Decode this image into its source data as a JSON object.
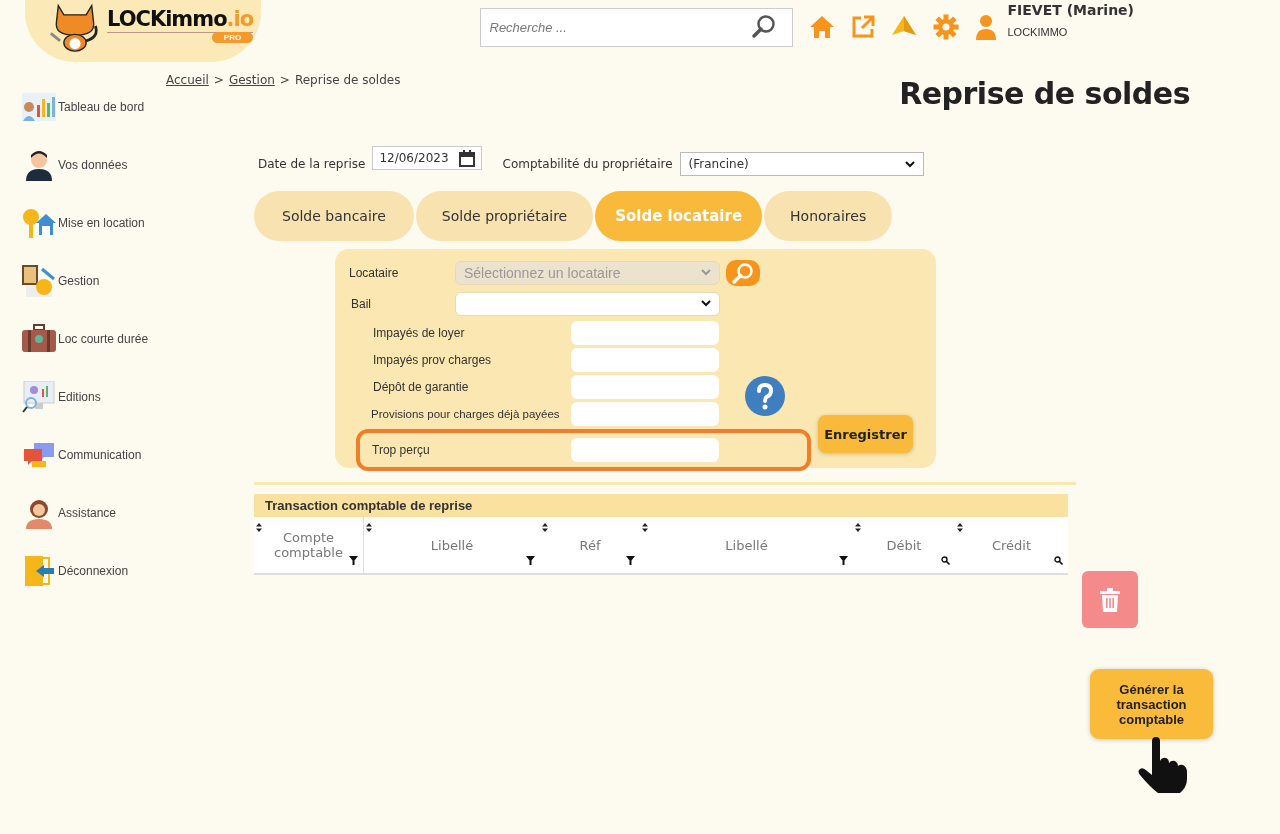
{
  "header": {
    "logo": {
      "name": "LOCKimmo",
      "suffix": ".io",
      "badge": "PRO"
    },
    "search": {
      "placeholder": "Recherche ..."
    },
    "user": {
      "name": "FIEVET (Marine)",
      "company": "LOCKIMMO"
    }
  },
  "breadcrumb": {
    "separator": ">",
    "items": [
      {
        "label": "Accueil",
        "link": true
      },
      {
        "label": "Gestion",
        "link": true
      },
      {
        "label": "Reprise de soldes",
        "link": false
      }
    ]
  },
  "page_title": "Reprise de soldes",
  "sidebar": {
    "items": [
      {
        "label": "Tableau de bord",
        "kind": "dashboard"
      },
      {
        "label": "Vos données",
        "kind": "person"
      },
      {
        "label": "Mise en location",
        "kind": "key-house"
      },
      {
        "label": "Gestion",
        "kind": "calculator"
      },
      {
        "label": "Loc courte durée",
        "kind": "suitcase"
      },
      {
        "label": "Editions",
        "kind": "monitor"
      },
      {
        "label": "Communication",
        "kind": "chat"
      },
      {
        "label": "Assistance",
        "kind": "support"
      },
      {
        "label": "Déconnexion",
        "kind": "logout"
      }
    ]
  },
  "date_field": {
    "label": "Date de la reprise",
    "value": "12/06/2023"
  },
  "owner_account": {
    "label": "Comptabilité du propriétaire",
    "value": "(Francine)"
  },
  "tabs": [
    {
      "label": "Solde bancaire",
      "selected": false
    },
    {
      "label": "Solde propriétaire",
      "selected": false
    },
    {
      "label": "Solde locataire",
      "selected": true
    },
    {
      "label": "Honoraires",
      "selected": false
    }
  ],
  "form": {
    "rows": [
      {
        "kind": "select",
        "label": "Locataire",
        "placeholder": "Sélectionnez un locataire",
        "disabled": true,
        "search_button": true,
        "highlighted": false
      },
      {
        "kind": "select",
        "label": "Bail",
        "disabled": false,
        "search_button": false,
        "highlighted": false
      },
      {
        "kind": "input",
        "label": "Impayés de loyer",
        "highlighted": false
      },
      {
        "kind": "input",
        "label": "Impayés prov charges",
        "highlighted": false
      },
      {
        "kind": "input",
        "label": "Dépôt de garantie",
        "highlighted": false
      },
      {
        "kind": "input",
        "label": "Provisions pour charges déjà payées",
        "highlighted": false
      },
      {
        "kind": "input",
        "label": "Trop perçu",
        "highlighted": true
      }
    ],
    "save_button": "Enregistrer"
  },
  "table": {
    "title": "Transaction comptable de reprise",
    "columns": [
      {
        "label": "Compte comptable",
        "kind": "funnel"
      },
      {
        "label": "Libellé",
        "kind": "funnel"
      },
      {
        "label": "Réf",
        "kind": "funnel"
      },
      {
        "label": "Libellé",
        "kind": "funnel"
      },
      {
        "label": "Débit",
        "kind": "search"
      },
      {
        "label": "Crédit",
        "kind": "search"
      }
    ]
  },
  "generate_button": "Générer la transaction comptable"
}
